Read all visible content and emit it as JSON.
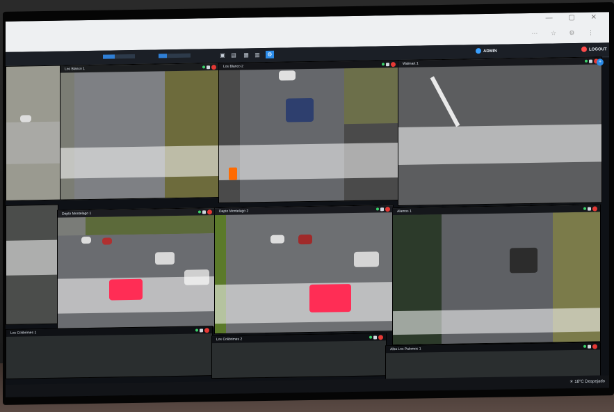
{
  "toolbar": {
    "stat_mem_label": "",
    "stat_mem_pct": 0.36,
    "stat_cpu_pct": 0.27,
    "nav": [
      {
        "label": "ADMIN",
        "color": "#3aa0ff"
      },
      {
        "label": "LOGOUT",
        "color": "#ff4b4b"
      }
    ]
  },
  "cameras": [
    {
      "title": "Los Blanco 1"
    },
    {
      "title": "Los Blanco 2"
    },
    {
      "title": "Walmart 1"
    },
    {
      "title": "Depto Montelago 1"
    },
    {
      "title": "Depto Montelago 2"
    },
    {
      "title": "Alamos 1"
    },
    {
      "title": "Los Colibrimes 1"
    },
    {
      "title": "Los Colibrimes 2"
    },
    {
      "title": "Alba Los Palomos 1"
    }
  ],
  "taskbar": {
    "weather": "18°C  Despejado"
  },
  "colors": {
    "accent": "#2b8be8",
    "record": "#e53935",
    "online": "#3ad26a"
  },
  "icons": [
    "window-minimize-icon",
    "window-maximize-icon",
    "window-close-icon",
    "record-icon",
    "settings-icon",
    "weather-icon"
  ]
}
